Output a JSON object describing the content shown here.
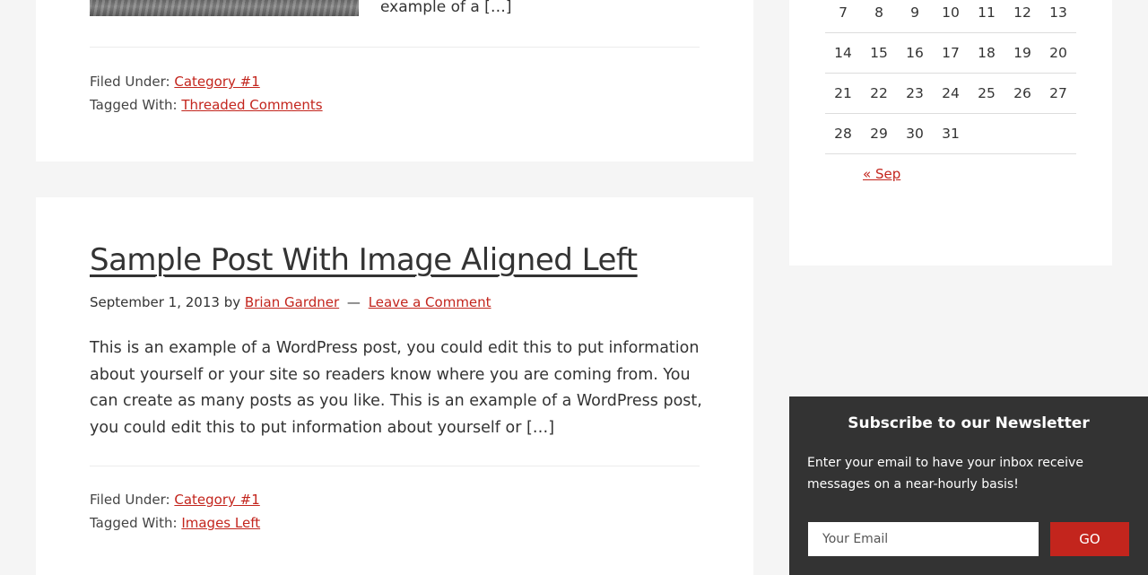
{
  "post_previous": {
    "excerpt_tail": "example of a […]",
    "filed_under_label": "Filed Under:",
    "category": "Category #1",
    "tagged_with_label": "Tagged With:",
    "tag": "Threaded Comments"
  },
  "post": {
    "title": "Sample Post With Image Aligned Left",
    "date": "September 1, 2013",
    "by_label": "by",
    "author": "Brian Gardner",
    "separator": "—",
    "comment_link": "Leave a Comment",
    "excerpt": "This is an example of a WordPress post, you could edit this to put information about yourself or your site so readers know where you are coming from. You can create as many posts as you like. This is an example of a WordPress post, you could edit this to put information about yourself or […]",
    "filed_under_label": "Filed Under:",
    "category": "Category #1",
    "tagged_with_label": "Tagged With:",
    "tag": "Images Left"
  },
  "calendar": {
    "weeks": [
      [
        "7",
        "8",
        "9",
        "10",
        "11",
        "12",
        "13"
      ],
      [
        "14",
        "15",
        "16",
        "17",
        "18",
        "19",
        "20"
      ],
      [
        "21",
        "22",
        "23",
        "24",
        "25",
        "26",
        "27"
      ],
      [
        "28",
        "29",
        "30",
        "31",
        "",
        "",
        ""
      ]
    ],
    "prev_link": "« Sep"
  },
  "newsletter": {
    "title": "Subscribe to our Newsletter",
    "description": "Enter your email to have your inbox receive messages on a near-hourly basis!",
    "email_placeholder": "Your Email",
    "button_label": "GO"
  },
  "colors": {
    "link": "#c3251d",
    "newsletter_bg": "#333333",
    "button_bg": "#c3251d",
    "page_bg": "#f5f5f5"
  }
}
